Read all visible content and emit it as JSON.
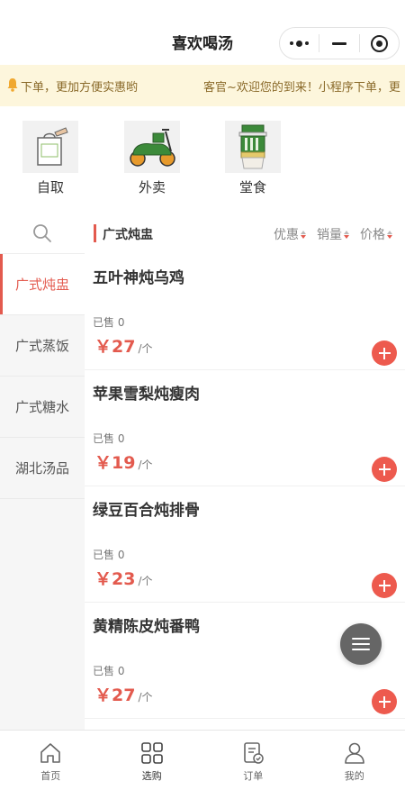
{
  "header": {
    "title": "喜欢喝汤"
  },
  "notice": {
    "text_left": "下单，更加方便实惠哟",
    "text_right": "客官~欢迎您的到来！小程序下单，更"
  },
  "modes": [
    {
      "label": "自取",
      "icon": "takeout-bag-icon"
    },
    {
      "label": "外卖",
      "icon": "scooter-icon"
    },
    {
      "label": "堂食",
      "icon": "soup-cup-icon"
    }
  ],
  "sidebar": {
    "items": [
      {
        "label": "广式炖盅",
        "active": true
      },
      {
        "label": "广式蒸饭",
        "active": false
      },
      {
        "label": "广式糖水",
        "active": false
      },
      {
        "label": "湖北汤品",
        "active": false
      }
    ]
  },
  "section": {
    "title": "广式炖盅",
    "sorts": [
      "优惠",
      "销量",
      "价格"
    ]
  },
  "products": [
    {
      "name": "五叶神炖乌鸡",
      "sold": "已售 0",
      "price": "￥27",
      "unit": "/个"
    },
    {
      "name": "苹果雪梨炖瘦肉",
      "sold": "已售 0",
      "price": "￥19",
      "unit": "/个"
    },
    {
      "name": "绿豆百合炖排骨",
      "sold": "已售 0",
      "price": "￥23",
      "unit": "/个"
    },
    {
      "name": "黄精陈皮炖番鸭",
      "sold": "已售 0",
      "price": "￥27",
      "unit": "/个"
    }
  ],
  "tabbar": [
    {
      "label": "首页",
      "icon": "home-icon"
    },
    {
      "label": "选购",
      "icon": "grid-icon",
      "active": true
    },
    {
      "label": "订单",
      "icon": "order-icon"
    },
    {
      "label": "我的",
      "icon": "user-icon"
    }
  ],
  "colors": {
    "accent": "#e35a4e",
    "notice_bg": "#fdf6dc",
    "sidebar_bg": "#f6f6f6"
  }
}
